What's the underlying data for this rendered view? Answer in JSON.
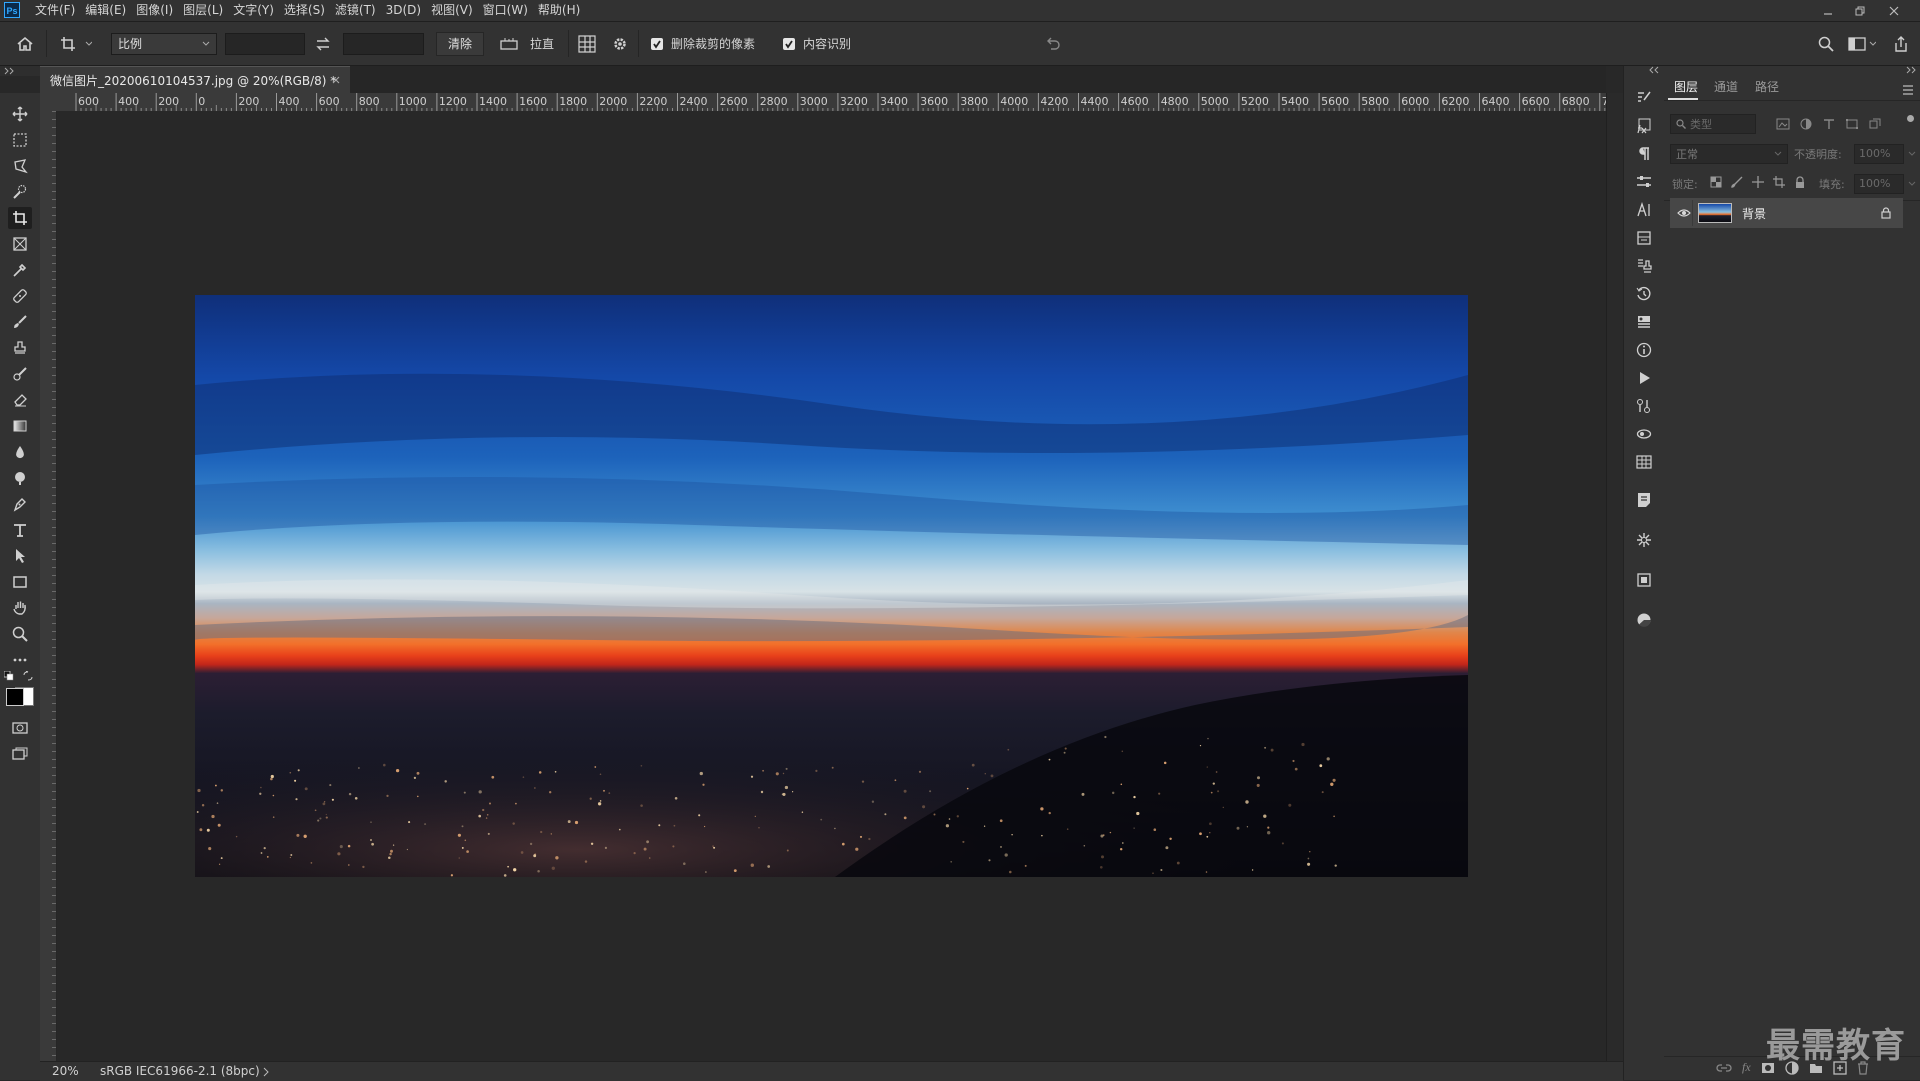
{
  "app": {
    "logo": "Ps"
  },
  "menu": [
    "文件(F)",
    "编辑(E)",
    "图像(I)",
    "图层(L)",
    "文字(Y)",
    "选择(S)",
    "滤镜(T)",
    "3D(D)",
    "视图(V)",
    "窗口(W)",
    "帮助(H)"
  ],
  "options": {
    "ratio_select": "比例",
    "width_value": "",
    "height_value": "",
    "clear_label": "清除",
    "straighten_label": "拉直",
    "delete_cropped_label": "删除裁剪的像素",
    "delete_cropped_checked": true,
    "content_aware_label": "内容识别",
    "content_aware_checked": true
  },
  "document": {
    "tab_title": "微信图片_20200610104537.jpg @ 20%(RGB/8) *",
    "zoom": "20%",
    "color_profile": "sRGB IEC61966-2.1 (8bpc)"
  },
  "ruler": {
    "h_labels": [
      "600",
      "400",
      "200",
      "0",
      "200",
      "400",
      "600",
      "800",
      "1000",
      "1200",
      "1400",
      "1600",
      "1800",
      "2000",
      "2200",
      "2400",
      "2600",
      "2800",
      "3000",
      "3200",
      "3400",
      "3600",
      "3800",
      "4000",
      "4200",
      "4400",
      "4600",
      "4800",
      "5000",
      "5200",
      "5400",
      "5600",
      "5800",
      "6000",
      "6200",
      "6400",
      "6600",
      "6800",
      "7"
    ]
  },
  "layers_panel": {
    "tabs": [
      "图层",
      "通道",
      "路径"
    ],
    "active_tab": 0,
    "search_placeholder": "类型",
    "blend_mode": "正常",
    "opacity_label": "不透明度:",
    "opacity_value": "100%",
    "lock_label": "锁定:",
    "fill_label": "填充:",
    "fill_value": "100%",
    "layers": [
      {
        "name": "背景",
        "visible": true,
        "locked": true
      }
    ]
  },
  "watermark": "最需教育",
  "colors": {
    "accent": "#31a8ff",
    "panel_bg": "#323232",
    "canvas_bg": "#282828"
  }
}
